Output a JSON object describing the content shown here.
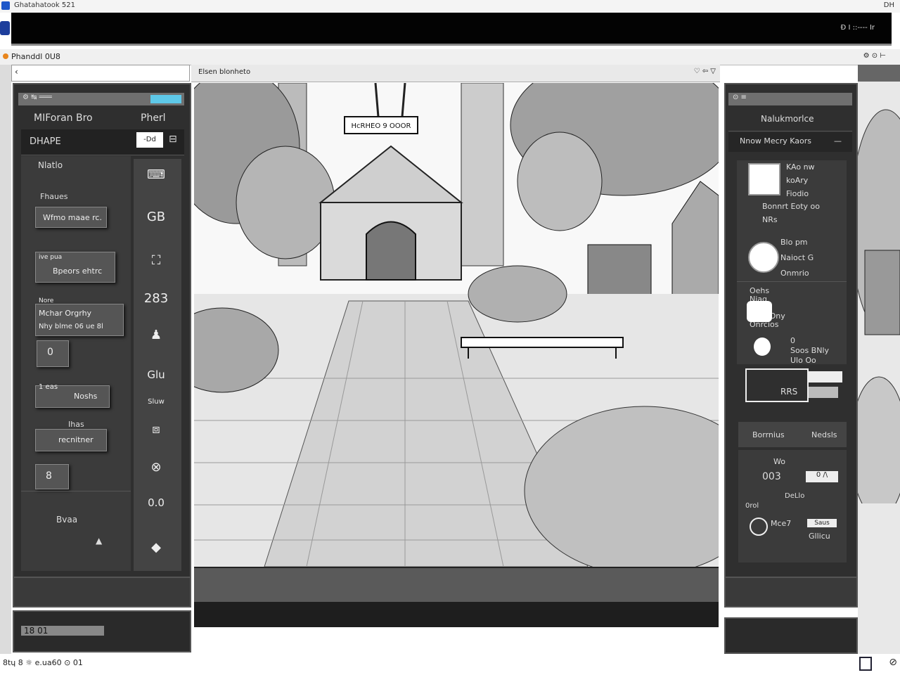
{
  "os": {
    "title": "Ghatahatook 521",
    "right": "DH"
  },
  "topbar": {
    "right_text": "Ð I ::---- Ir"
  },
  "app": {
    "title": "Phanddl 0U8"
  },
  "doc": {
    "tab_label": "Elsen blonheto"
  },
  "left_panel": {
    "header_left": "MIForan Bro",
    "header_right": "Pherl",
    "row_label": "DHAPE",
    "row_field": "-Dd",
    "section_label": "Nlatlo",
    "cards": [
      {
        "small": "Fhaues",
        "main": "Wfmo maae rc."
      },
      {
        "small": "ive  pua",
        "main": "Bpeors ehtrc"
      },
      {
        "small": "Nore",
        "line1": "Mchar Orgrhy",
        "line2": "Nhy blme 06 ue 8l"
      },
      {
        "small": "0",
        "main": ""
      },
      {
        "small": "1 eas",
        "main": "Noshs"
      },
      {
        "small": "Ihas",
        "main": "recnitner"
      },
      {
        "small": "8",
        "main": ""
      }
    ],
    "bottom_label": "Bvaa",
    "tools": [
      "⌨",
      "GB",
      "⛶",
      "283",
      "♟",
      "Glu",
      "Sluw",
      "⧈",
      "⊗",
      "0.0",
      "◆"
    ],
    "footer_text": "18 01"
  },
  "right_panel": {
    "header": "Nalukmorlce",
    "subheader": "Nnow Mecry Kaors",
    "items": [
      {
        "label": "KAo nw\nkoAry\nFiodio"
      },
      {
        "label": "Bonnrt Eoty oo\nNRs"
      },
      {
        "label": "Blo pm\nNaioct G\nOnmrio"
      },
      {
        "label": "Oehs\nNiag\nOurol\nYTeo Ony\nOnrcios"
      },
      {
        "label": "0\nSoos  BNly\nUlo  Oo"
      },
      {
        "label": "RRS"
      }
    ],
    "tab_left": "Borrnius",
    "tab_right": "Nedsls",
    "lower": [
      "Wo",
      "003",
      "0 /\\",
      "DeLlo",
      "0rol",
      "Mce7",
      "Saus",
      "Gllicu"
    ]
  },
  "status": {
    "left": "8tɥ 8 ☼ e.ua60 ⊙ 01"
  },
  "canvas": {
    "sign": "HcRHEO 9 OOOR"
  }
}
